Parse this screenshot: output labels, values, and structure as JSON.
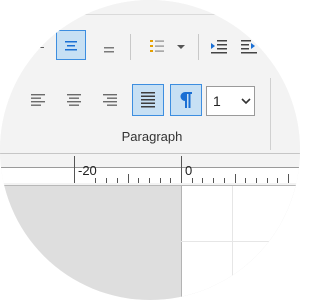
{
  "ribbon": {
    "group_label": "Paragraph",
    "row1": {
      "buttons": [
        {
          "name": "align-left-icon"
        },
        {
          "name": "align-center-icon",
          "selected": true
        },
        {
          "name": "align-right-icon"
        },
        {
          "name": "bullet-list-icon"
        },
        {
          "name": "chevron-down-icon"
        },
        {
          "name": "indent-decrease-icon"
        },
        {
          "name": "indent-increase-icon"
        }
      ]
    },
    "row2": {
      "buttons": [
        {
          "name": "align-left-icon"
        },
        {
          "name": "align-center-icon"
        },
        {
          "name": "align-right-icon"
        },
        {
          "name": "justify-icon",
          "selected": true
        },
        {
          "name": "paragraph-mark-icon",
          "selected": true
        }
      ],
      "spacing_select": {
        "value": "1"
      }
    }
  },
  "ruler": {
    "labels": [
      "-20",
      "0"
    ]
  },
  "colors": {
    "ribbon_bg": "#f3f3f3",
    "selected_fill": "#c7e0f4",
    "selected_border": "#3d8ee0",
    "canvas_bg": "#dedede",
    "icon_gray": "#5f5f5f",
    "icon_blue": "#1a6fd4"
  }
}
